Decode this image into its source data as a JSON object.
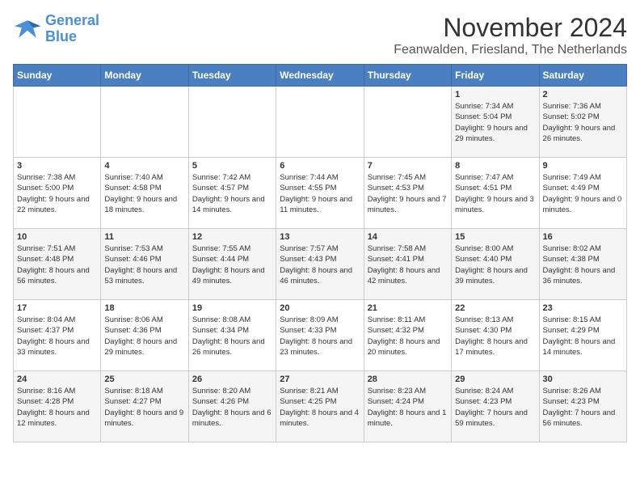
{
  "logo": {
    "line1": "General",
    "line2": "Blue"
  },
  "title": "November 2024",
  "location": "Feanwalden, Friesland, The Netherlands",
  "weekdays": [
    "Sunday",
    "Monday",
    "Tuesday",
    "Wednesday",
    "Thursday",
    "Friday",
    "Saturday"
  ],
  "weeks": [
    [
      {
        "day": "",
        "info": ""
      },
      {
        "day": "",
        "info": ""
      },
      {
        "day": "",
        "info": ""
      },
      {
        "day": "",
        "info": ""
      },
      {
        "day": "",
        "info": ""
      },
      {
        "day": "1",
        "info": "Sunrise: 7:34 AM\nSunset: 5:04 PM\nDaylight: 9 hours and 29 minutes."
      },
      {
        "day": "2",
        "info": "Sunrise: 7:36 AM\nSunset: 5:02 PM\nDaylight: 9 hours and 26 minutes."
      }
    ],
    [
      {
        "day": "3",
        "info": "Sunrise: 7:38 AM\nSunset: 5:00 PM\nDaylight: 9 hours and 22 minutes."
      },
      {
        "day": "4",
        "info": "Sunrise: 7:40 AM\nSunset: 4:58 PM\nDaylight: 9 hours and 18 minutes."
      },
      {
        "day": "5",
        "info": "Sunrise: 7:42 AM\nSunset: 4:57 PM\nDaylight: 9 hours and 14 minutes."
      },
      {
        "day": "6",
        "info": "Sunrise: 7:44 AM\nSunset: 4:55 PM\nDaylight: 9 hours and 11 minutes."
      },
      {
        "day": "7",
        "info": "Sunrise: 7:45 AM\nSunset: 4:53 PM\nDaylight: 9 hours and 7 minutes."
      },
      {
        "day": "8",
        "info": "Sunrise: 7:47 AM\nSunset: 4:51 PM\nDaylight: 9 hours and 3 minutes."
      },
      {
        "day": "9",
        "info": "Sunrise: 7:49 AM\nSunset: 4:49 PM\nDaylight: 9 hours and 0 minutes."
      }
    ],
    [
      {
        "day": "10",
        "info": "Sunrise: 7:51 AM\nSunset: 4:48 PM\nDaylight: 8 hours and 56 minutes."
      },
      {
        "day": "11",
        "info": "Sunrise: 7:53 AM\nSunset: 4:46 PM\nDaylight: 8 hours and 53 minutes."
      },
      {
        "day": "12",
        "info": "Sunrise: 7:55 AM\nSunset: 4:44 PM\nDaylight: 8 hours and 49 minutes."
      },
      {
        "day": "13",
        "info": "Sunrise: 7:57 AM\nSunset: 4:43 PM\nDaylight: 8 hours and 46 minutes."
      },
      {
        "day": "14",
        "info": "Sunrise: 7:58 AM\nSunset: 4:41 PM\nDaylight: 8 hours and 42 minutes."
      },
      {
        "day": "15",
        "info": "Sunrise: 8:00 AM\nSunset: 4:40 PM\nDaylight: 8 hours and 39 minutes."
      },
      {
        "day": "16",
        "info": "Sunrise: 8:02 AM\nSunset: 4:38 PM\nDaylight: 8 hours and 36 minutes."
      }
    ],
    [
      {
        "day": "17",
        "info": "Sunrise: 8:04 AM\nSunset: 4:37 PM\nDaylight: 8 hours and 33 minutes."
      },
      {
        "day": "18",
        "info": "Sunrise: 8:06 AM\nSunset: 4:36 PM\nDaylight: 8 hours and 29 minutes."
      },
      {
        "day": "19",
        "info": "Sunrise: 8:08 AM\nSunset: 4:34 PM\nDaylight: 8 hours and 26 minutes."
      },
      {
        "day": "20",
        "info": "Sunrise: 8:09 AM\nSunset: 4:33 PM\nDaylight: 8 hours and 23 minutes."
      },
      {
        "day": "21",
        "info": "Sunrise: 8:11 AM\nSunset: 4:32 PM\nDaylight: 8 hours and 20 minutes."
      },
      {
        "day": "22",
        "info": "Sunrise: 8:13 AM\nSunset: 4:30 PM\nDaylight: 8 hours and 17 minutes."
      },
      {
        "day": "23",
        "info": "Sunrise: 8:15 AM\nSunset: 4:29 PM\nDaylight: 8 hours and 14 minutes."
      }
    ],
    [
      {
        "day": "24",
        "info": "Sunrise: 8:16 AM\nSunset: 4:28 PM\nDaylight: 8 hours and 12 minutes."
      },
      {
        "day": "25",
        "info": "Sunrise: 8:18 AM\nSunset: 4:27 PM\nDaylight: 8 hours and 9 minutes."
      },
      {
        "day": "26",
        "info": "Sunrise: 8:20 AM\nSunset: 4:26 PM\nDaylight: 8 hours and 6 minutes."
      },
      {
        "day": "27",
        "info": "Sunrise: 8:21 AM\nSunset: 4:25 PM\nDaylight: 8 hours and 4 minutes."
      },
      {
        "day": "28",
        "info": "Sunrise: 8:23 AM\nSunset: 4:24 PM\nDaylight: 8 hours and 1 minute."
      },
      {
        "day": "29",
        "info": "Sunrise: 8:24 AM\nSunset: 4:23 PM\nDaylight: 7 hours and 59 minutes."
      },
      {
        "day": "30",
        "info": "Sunrise: 8:26 AM\nSunset: 4:23 PM\nDaylight: 7 hours and 56 minutes."
      }
    ]
  ]
}
